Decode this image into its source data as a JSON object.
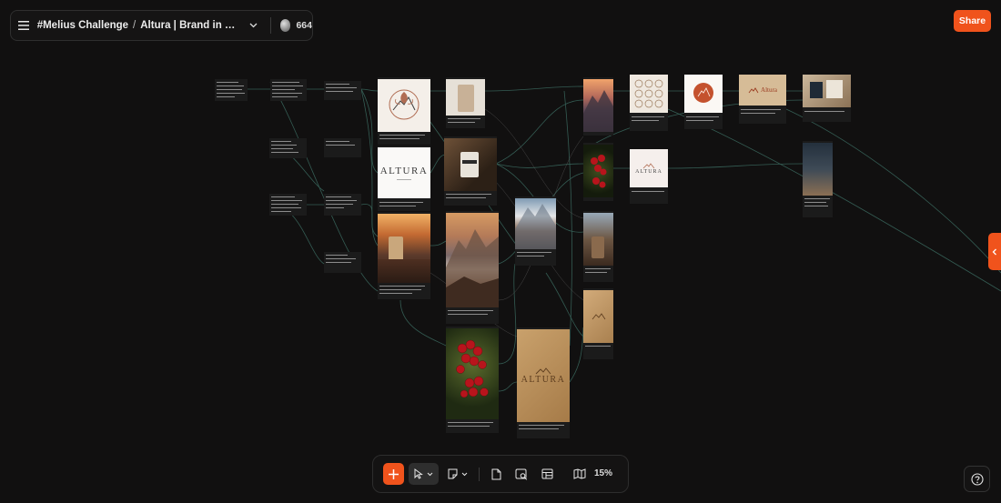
{
  "header": {
    "workspace": "#Melius Challenge",
    "separator": "/",
    "project": "Altura | Brand in minut...",
    "credits": "664",
    "menu_icon": "hamburger-menu-icon",
    "chevron_icon": "chevron-down-icon",
    "credit_icon": "coin-icon"
  },
  "share_label": "Share",
  "toolbar": {
    "zoom": "15%",
    "icons": [
      "plus-icon",
      "cursor-select-icon",
      "sticky-note-icon",
      "document-icon",
      "image-icon",
      "layout-icon",
      "map-icon"
    ]
  },
  "colors": {
    "accent": "#f0531c",
    "background": "#111010",
    "wire": "#4a8a7a"
  },
  "canvas": {
    "brand_texts": {
      "altura_wordmark": "ALTURA",
      "altura_small": "Altura",
      "bag_label": "ALTURA"
    }
  }
}
